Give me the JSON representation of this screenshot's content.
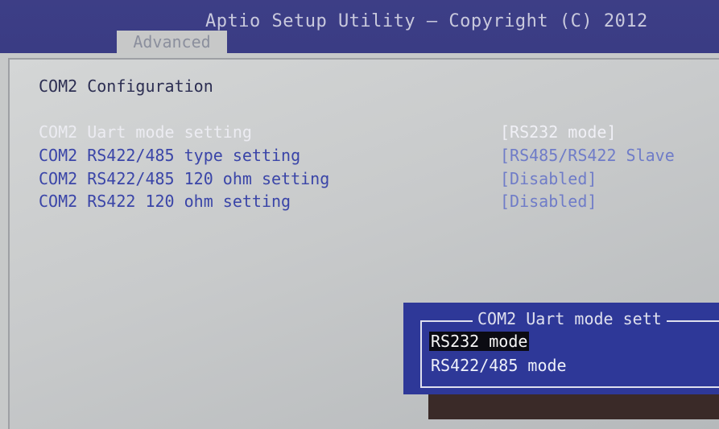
{
  "header": {
    "title": "Aptio Setup Utility – Copyright (C) 2012",
    "active_tab": "Advanced"
  },
  "page": {
    "heading": "COM2 Configuration",
    "settings": [
      {
        "label": "COM2 Uart mode setting",
        "value": "[RS232 mode]",
        "selected": true
      },
      {
        "label": "COM2 RS422/485 type setting",
        "value": "[RS485/RS422 Slave",
        "selected": false
      },
      {
        "label": "COM2 RS422/485 120 ohm setting",
        "value": "[Disabled]",
        "selected": false
      },
      {
        "label": "COM2 RS422 120 ohm setting",
        "value": "[Disabled]",
        "selected": false
      }
    ]
  },
  "popup": {
    "title": "COM2 Uart mode sett",
    "options": [
      {
        "label": "RS232 mode",
        "highlighted": true
      },
      {
        "label": "RS422/485 mode",
        "highlighted": false
      }
    ]
  },
  "colors": {
    "title_bar": "#3d3e86",
    "panel": "#c7c9c9",
    "label_text": "#3a45a8",
    "selected_text": "#ececf2",
    "popup_bg": "#2e3898",
    "popup_highlight": "#0b0b12"
  }
}
